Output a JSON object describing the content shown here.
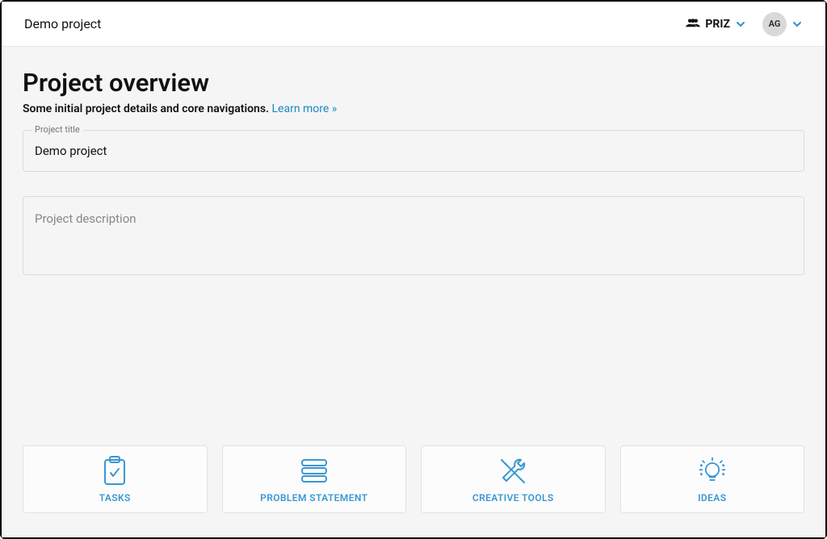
{
  "topbar": {
    "project_name": "Demo project",
    "workspace_label": "PRIZ",
    "user_initials": "AG"
  },
  "page": {
    "title": "Project overview",
    "subtitle": "Some initial project details and core navigations.",
    "learn_more": "Learn more »"
  },
  "fields": {
    "title_label": "Project title",
    "title_value": "Demo project",
    "description_placeholder": "Project description",
    "description_value": ""
  },
  "nav_cards": [
    {
      "label": "TASKS"
    },
    {
      "label": "PROBLEM STATEMENT"
    },
    {
      "label": "CREATIVE TOOLS"
    },
    {
      "label": "IDEAS"
    }
  ]
}
